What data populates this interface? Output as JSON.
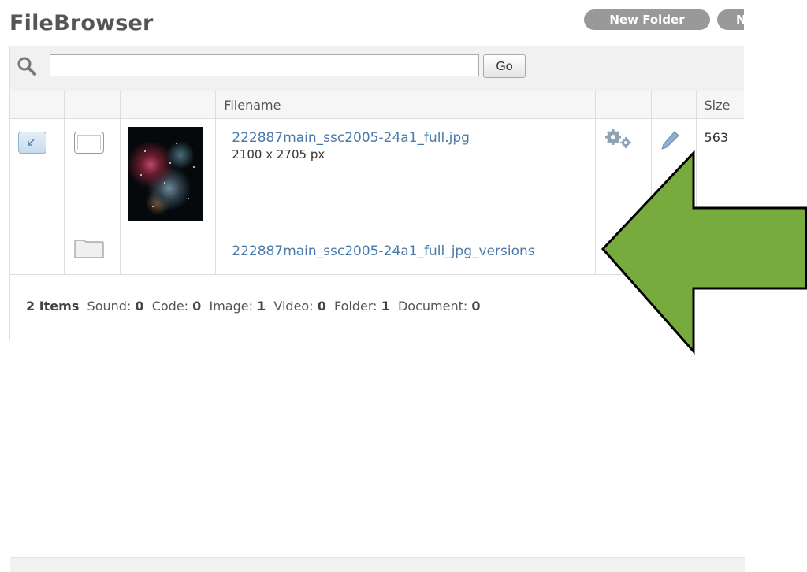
{
  "header": {
    "title": "FileBrowser",
    "new_folder": "New Folder",
    "second_button": "N"
  },
  "search": {
    "placeholder": "",
    "value": "",
    "go_label": "Go"
  },
  "table": {
    "columns": [
      "",
      "",
      "",
      "Filename",
      "",
      "",
      "Size"
    ],
    "rows": [
      {
        "filename": "222887main_ssc2005-24a1_full.jpg",
        "dimensions": "2100 x 2705 px",
        "size": "563"
      },
      {
        "filename": "222887main_ssc2005-24a1_full_jpg_versions"
      }
    ]
  },
  "summary": {
    "items_count": "2 Items",
    "sound_label": "Sound:",
    "sound": "0",
    "code_label": "Code:",
    "code": "0",
    "image_label": "Image:",
    "image": "1",
    "video_label": "Video:",
    "video": "0",
    "folder_label": "Folder:",
    "folder": "1",
    "document_label": "Document:",
    "document": "0"
  },
  "annotation": {
    "arrow_color": "#77ab3e"
  },
  "icons": [
    "search-icon",
    "select-arrow-icon",
    "checkbox-icon",
    "thumbnail-image",
    "gear-icon",
    "pencil-icon",
    "folder-icon"
  ]
}
